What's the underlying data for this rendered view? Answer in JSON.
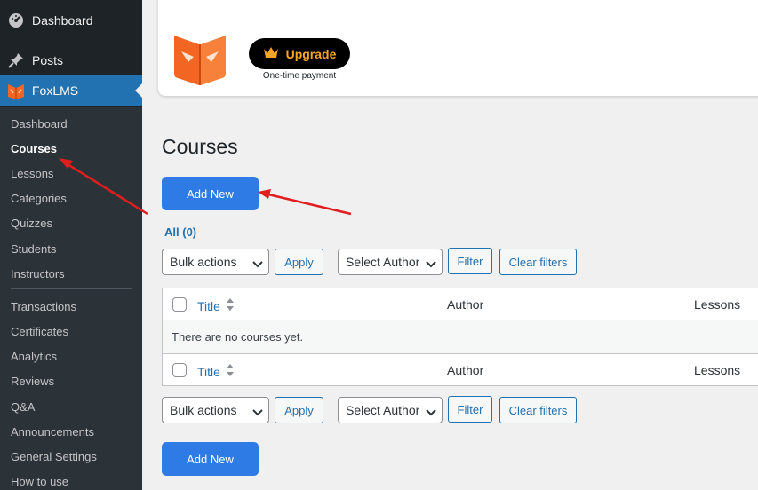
{
  "sidebar": {
    "top_items": [
      {
        "label": "Dashboard",
        "icon": "dashboard-icon"
      },
      {
        "label": "Posts",
        "icon": "pin-icon"
      },
      {
        "label": "FoxLMS",
        "icon": "foxlms-logo-icon"
      }
    ],
    "submenu": [
      {
        "label": "Dashboard"
      },
      {
        "label": "Courses",
        "current": true
      },
      {
        "label": "Lessons"
      },
      {
        "label": "Categories"
      },
      {
        "label": "Quizzes"
      },
      {
        "label": "Students"
      },
      {
        "label": "Instructors"
      },
      {
        "label": "Transactions"
      },
      {
        "label": "Certificates"
      },
      {
        "label": "Analytics"
      },
      {
        "label": "Reviews"
      },
      {
        "label": "Q&A"
      },
      {
        "label": "Announcements"
      },
      {
        "label": "General Settings"
      },
      {
        "label": "How to use"
      }
    ]
  },
  "upgrade_card": {
    "button_label": "Upgrade",
    "button_icon": "crown-icon",
    "subtext": "One-time payment"
  },
  "main": {
    "title": "Courses",
    "add_new_label": "Add New",
    "views": {
      "all_label": "All",
      "all_count": "(0)"
    },
    "bulk_actions_label": "Bulk actions",
    "apply_label": "Apply",
    "select_author_label": "Select Author",
    "filter_label": "Filter",
    "clear_filters_label": "Clear filters"
  },
  "table": {
    "columns": [
      "Title",
      "Author",
      "Lessons"
    ],
    "empty_message": "There are no courses yet."
  },
  "colors": {
    "sidebar_bg": "#1d2327",
    "active_menu": "#2271b1",
    "primary_button": "#2f7be5",
    "annotation_arrow": "#e01e1e",
    "upgrade_text": "#f5a623"
  }
}
